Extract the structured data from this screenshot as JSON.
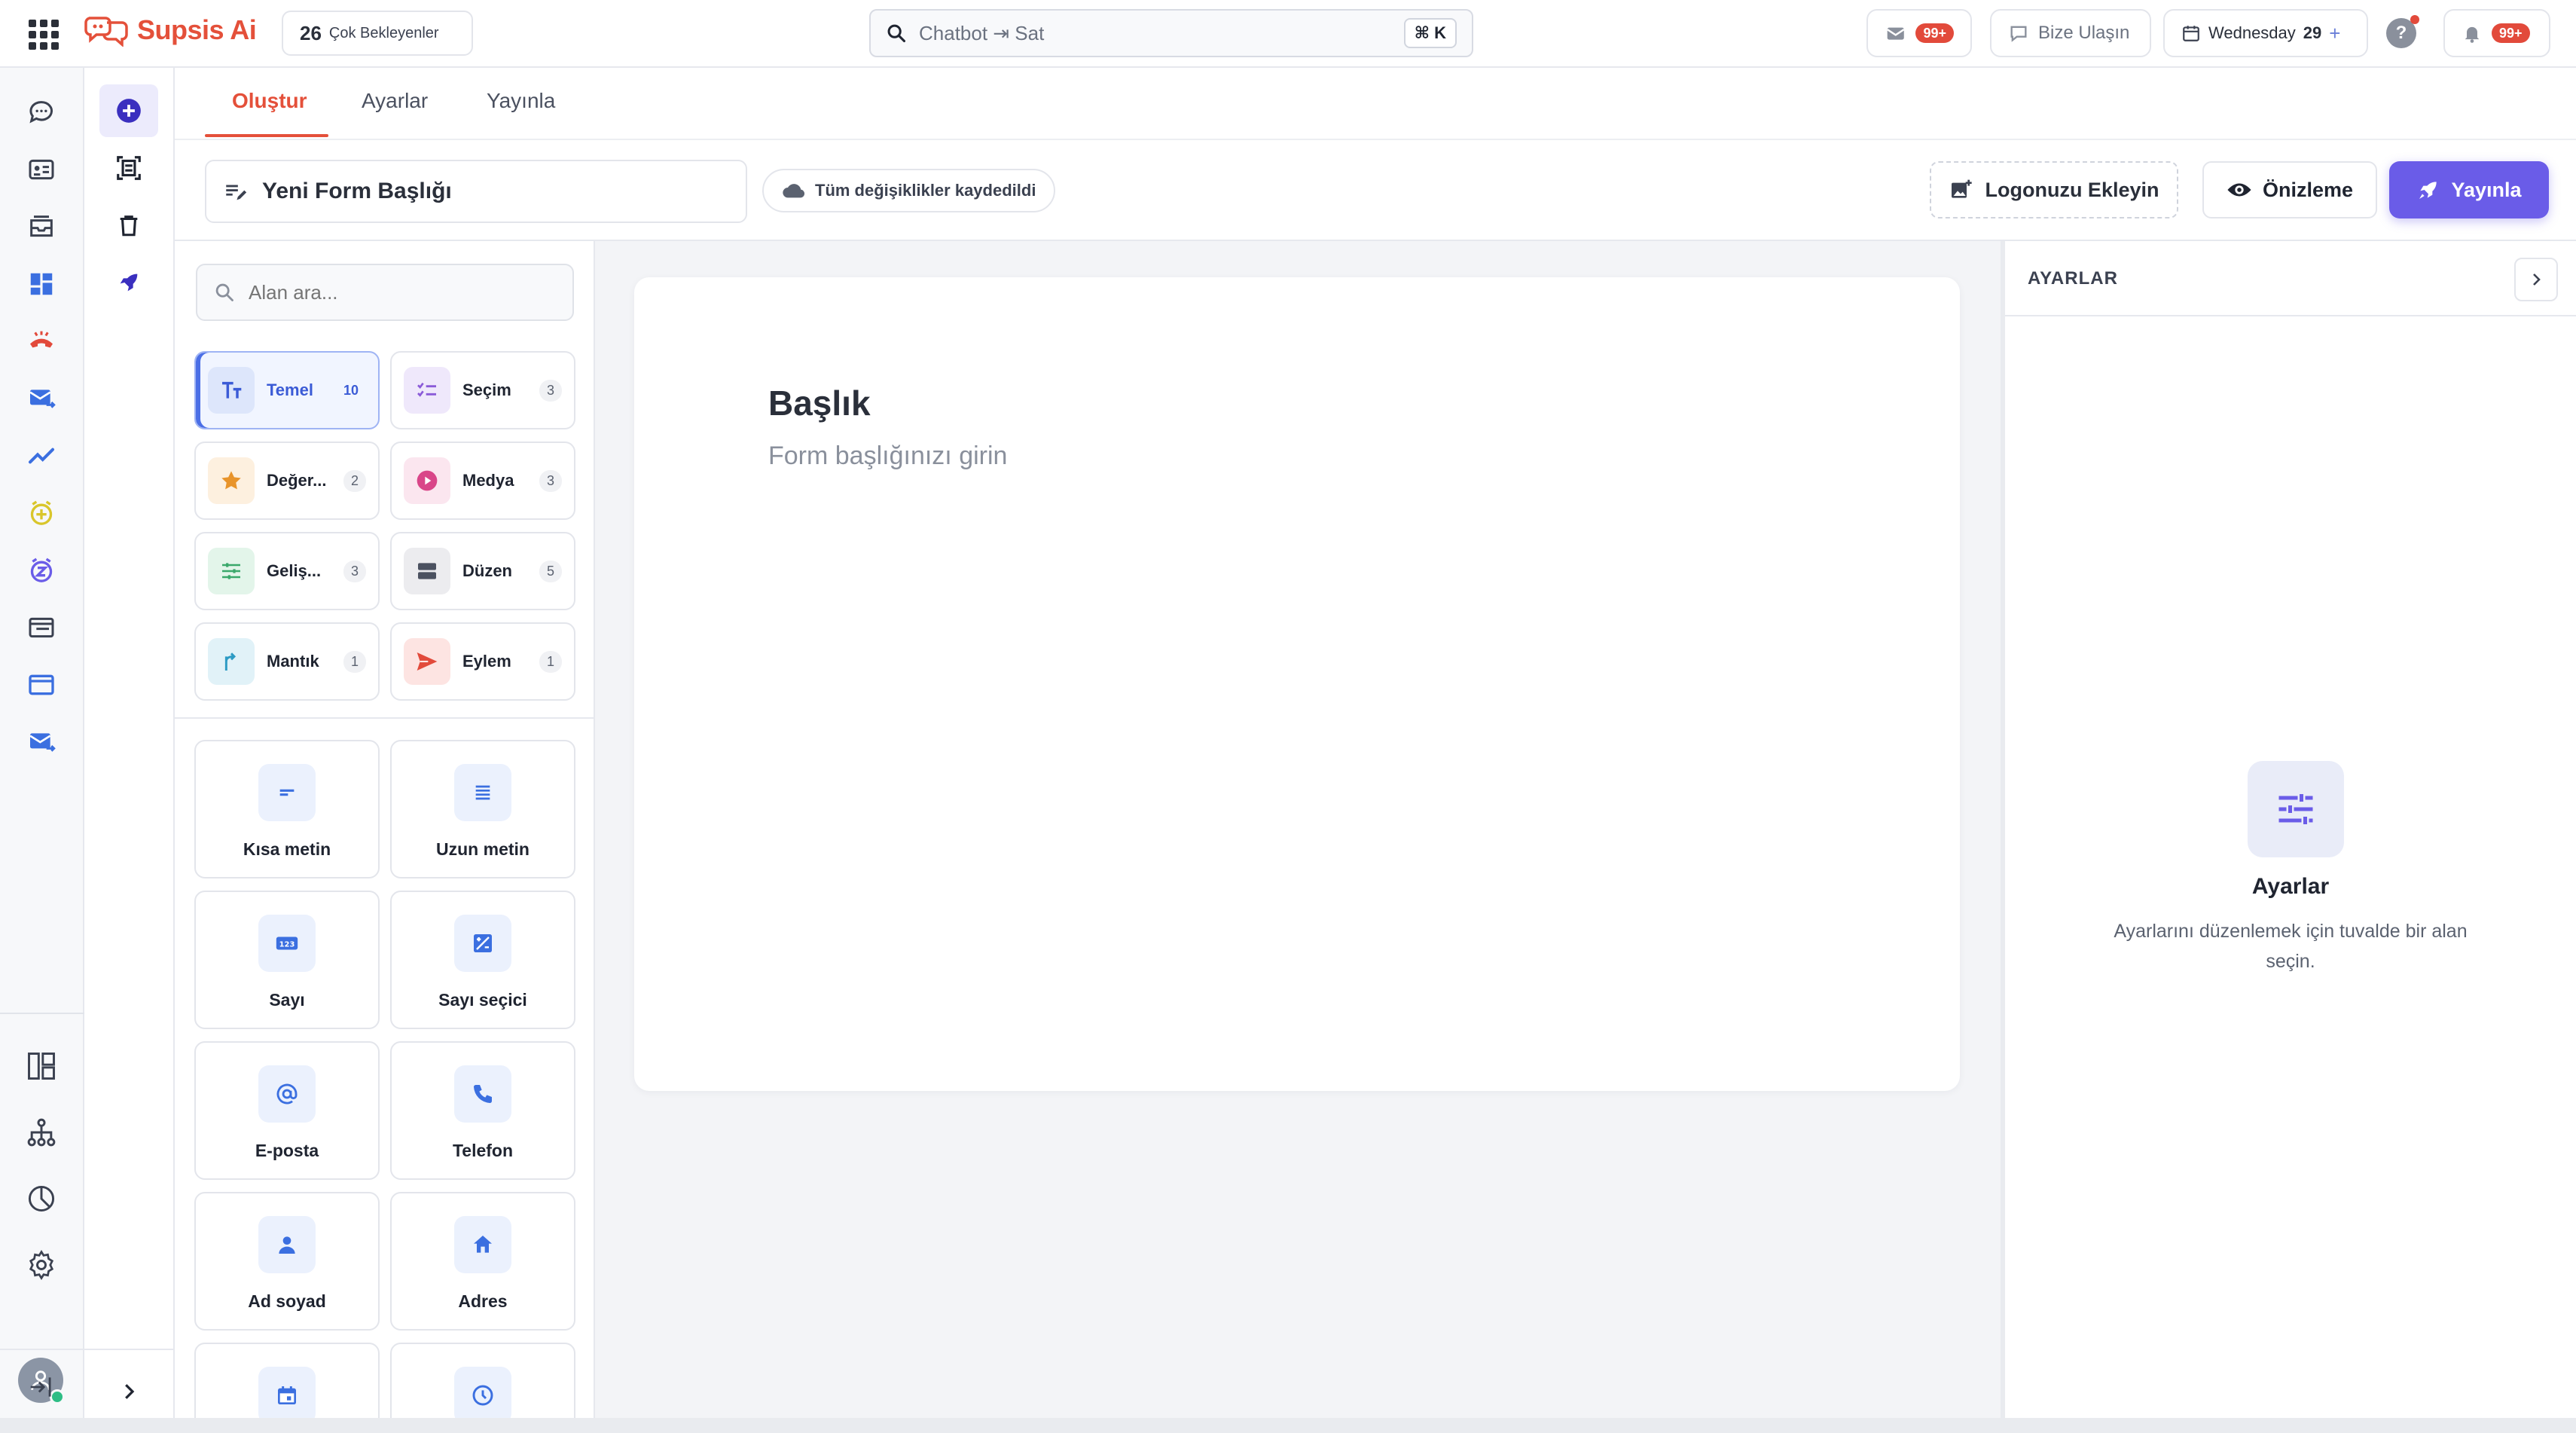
{
  "app": {
    "name": "Supsis Ai"
  },
  "topbar": {
    "pending_count": "26",
    "pending_label": "Çok Bekleyenler",
    "search_value": "Chatbot ⇥ Sat",
    "search_shortcut": "⌘ K",
    "mail_badge": "99+",
    "contact_label": "Bize Ulaşın",
    "date_day": "Wednesday",
    "date_num": "29",
    "date_add": "+",
    "help_label": "?",
    "notif_badge": "99+"
  },
  "tabs": [
    {
      "label": "Oluştur"
    },
    {
      "label": "Ayarlar"
    },
    {
      "label": "Yayınla"
    }
  ],
  "toolbar": {
    "form_title": "Yeni Form Başlığı",
    "saved_status": "Tüm değişiklikler kaydedildi",
    "logo_label": "Logonuzu Ekleyin",
    "preview_label": "Önizleme",
    "publish_label": "Yayınla"
  },
  "fields": {
    "search_placeholder": "Alan ara...",
    "categories": [
      {
        "name": "Temel",
        "count": "10"
      },
      {
        "name": "Seçim",
        "count": "3"
      },
      {
        "name": "Değer...",
        "count": "2"
      },
      {
        "name": "Medya",
        "count": "3"
      },
      {
        "name": "Geliş...",
        "count": "3"
      },
      {
        "name": "Düzen",
        "count": "5"
      },
      {
        "name": "Mantık",
        "count": "1"
      },
      {
        "name": "Eylem",
        "count": "1"
      }
    ],
    "tiles": [
      {
        "label": "Kısa metin",
        "icon": "short-text-icon"
      },
      {
        "label": "Uzun metin",
        "icon": "long-text-icon"
      },
      {
        "label": "Sayı",
        "icon": "number-icon"
      },
      {
        "label": "Sayı seçici",
        "icon": "number-picker-icon"
      },
      {
        "label": "E-posta",
        "icon": "at-icon"
      },
      {
        "label": "Telefon",
        "icon": "phone-icon"
      },
      {
        "label": "Ad soyad",
        "icon": "person-icon"
      },
      {
        "label": "Adres",
        "icon": "home-icon"
      },
      {
        "label": "",
        "icon": "calendar-icon"
      },
      {
        "label": "",
        "icon": "clock-icon"
      }
    ]
  },
  "canvas": {
    "title": "Başlık",
    "subtitle": "Form başlığınızı girin"
  },
  "settings": {
    "header": "AYARLAR",
    "empty_title": "Ayarlar",
    "empty_desc": "Ayarlarını düzenlemek için tuvalde bir alan seçin."
  },
  "colors": {
    "brand": "#e4503a",
    "accent": "#6a5ce8",
    "active_blue": "#3b5bd6"
  }
}
